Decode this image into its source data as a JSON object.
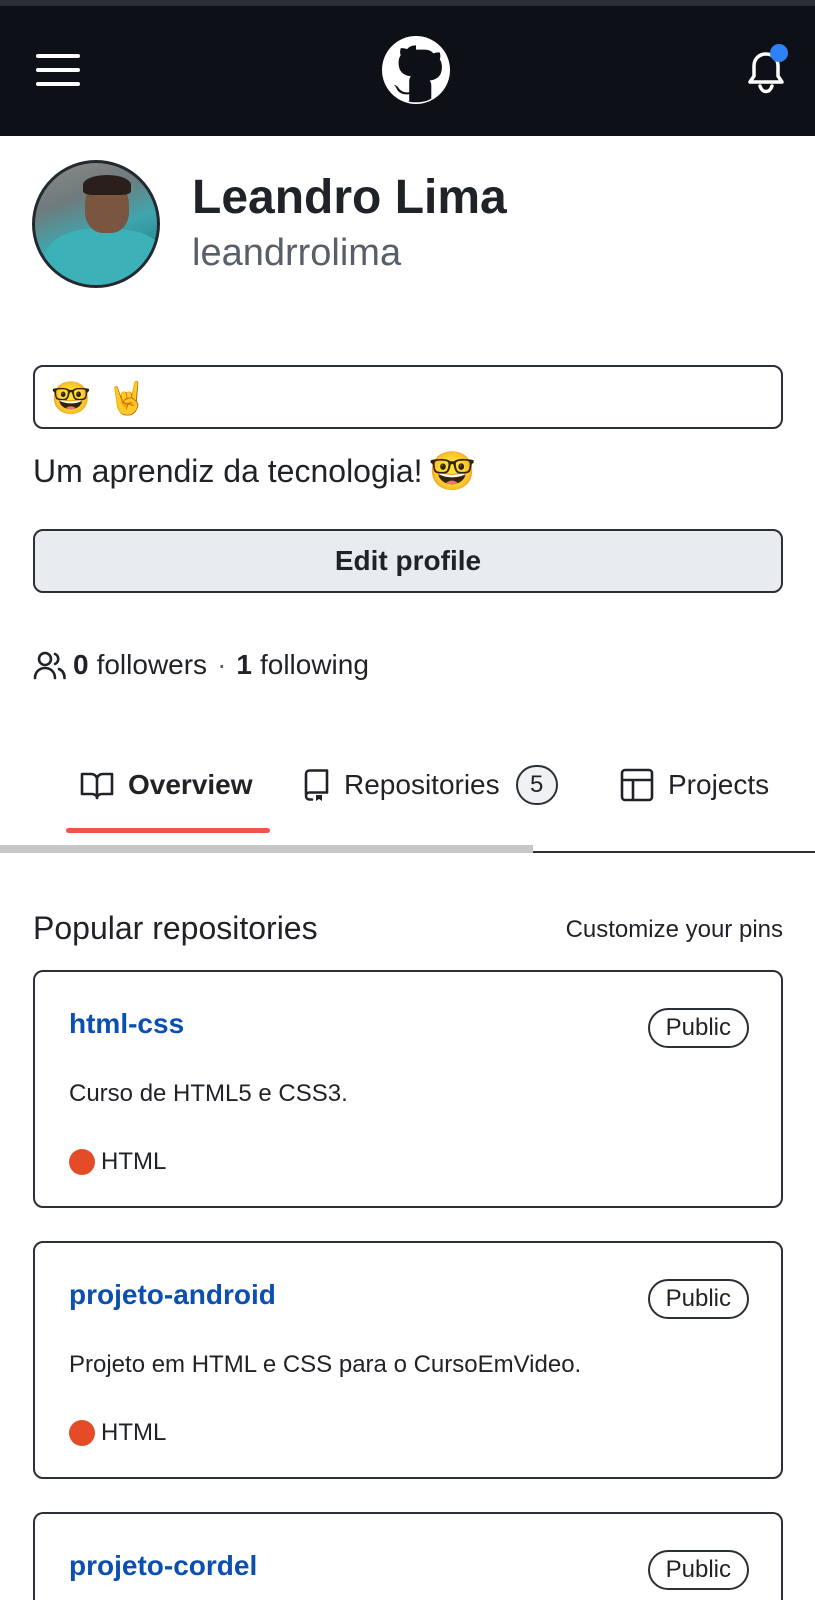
{
  "header": {
    "menu_icon": "hamburger-menu-icon",
    "logo_icon": "github-logo-icon",
    "notification_icon": "bell-icon",
    "notification_dot_color": "#2f81f7"
  },
  "profile": {
    "full_name": "Leandro Lima",
    "login": "leandrrolima",
    "status_emoji_1": "🤓",
    "status_emoji_2": "🤘",
    "bio_text": "Um aprendiz da tecnologia!",
    "bio_emoji": "🤓",
    "edit_label": "Edit profile",
    "followers_count": "0",
    "followers_label": "followers",
    "separator": "·",
    "following_count": "1",
    "following_label": "following"
  },
  "tabs": {
    "overview": "Overview",
    "repositories": "Repositories",
    "repositories_count": "5",
    "projects": "Projects",
    "active_color": "#f0554a"
  },
  "popular": {
    "title": "Popular repositories",
    "customize": "Customize your pins",
    "repos": [
      {
        "name": "html-css",
        "visibility": "Public",
        "description": "Curso de HTML5 e CSS3.",
        "language": "HTML",
        "language_color": "#e34c26"
      },
      {
        "name": "projeto-android",
        "visibility": "Public",
        "description": "Projeto em HTML e CSS para o CursoEmVideo.",
        "language": "HTML",
        "language_color": "#e34c26"
      },
      {
        "name": "projeto-cordel",
        "visibility": "Public"
      }
    ]
  }
}
